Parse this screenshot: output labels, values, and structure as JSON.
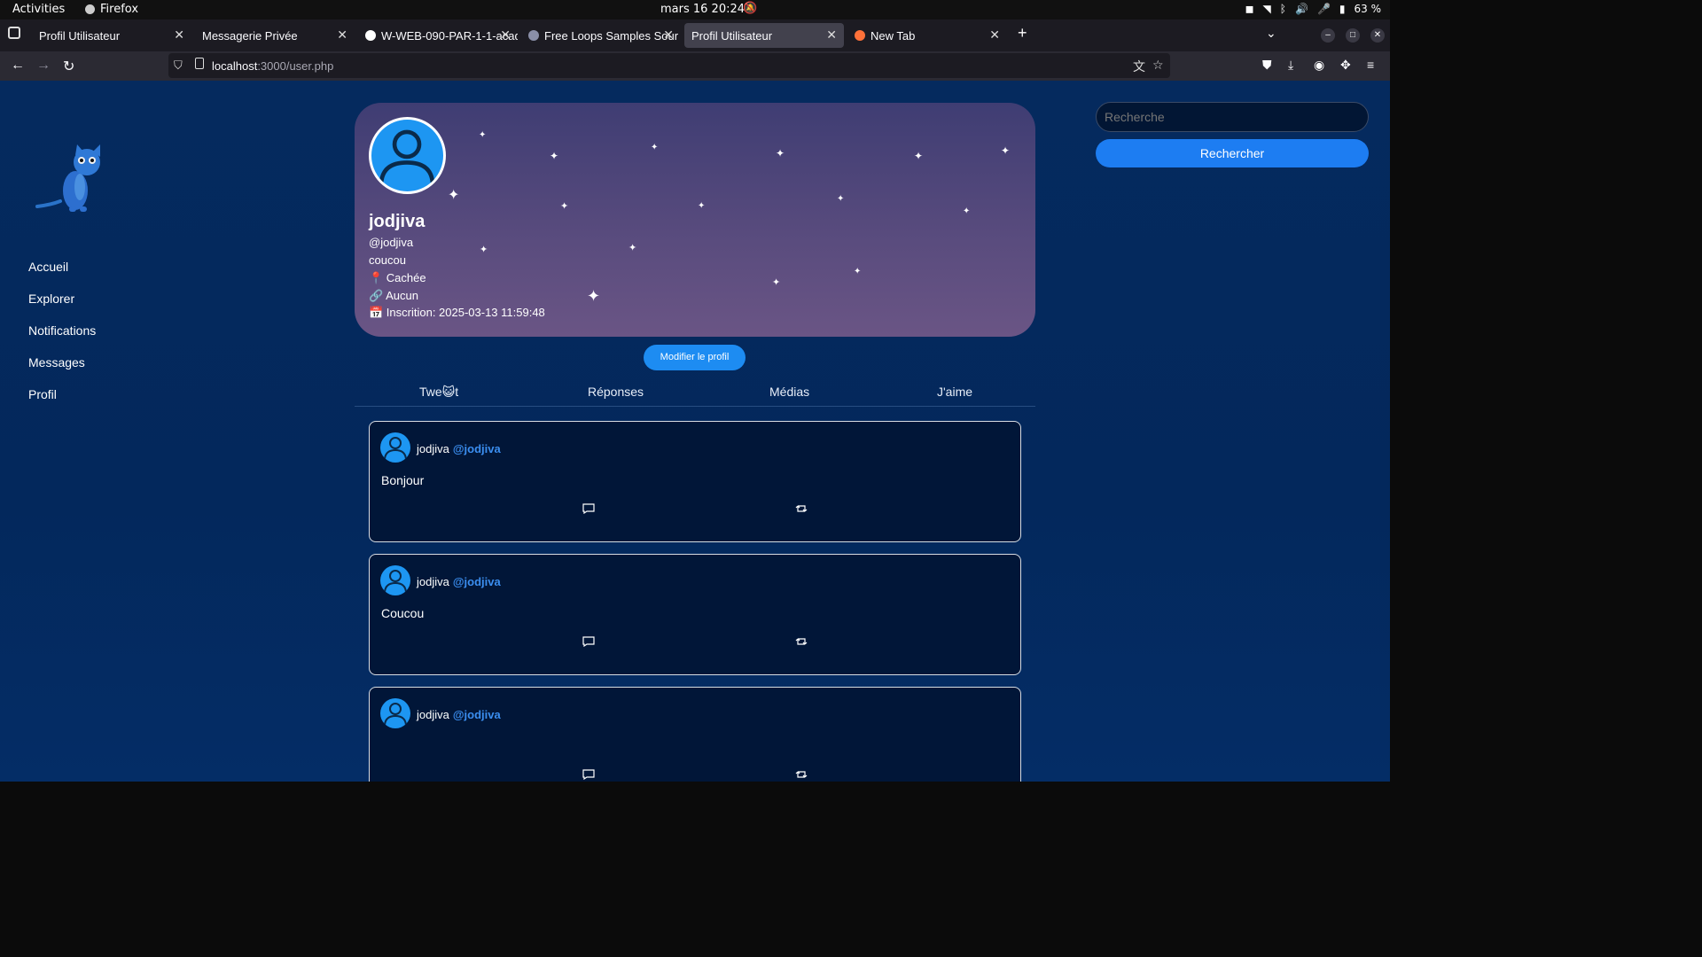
{
  "system": {
    "activities": "Activities",
    "app_name": "Firefox",
    "clock": "mars 16  20:24",
    "battery": "63 %"
  },
  "browser": {
    "tabs": [
      {
        "title": "Profil Utilisateur",
        "active": false
      },
      {
        "title": "Messagerie Privée",
        "active": false
      },
      {
        "title": "W-WEB-090-PAR-1-1-acad",
        "active": false
      },
      {
        "title": "Free Loops Samples Sour",
        "active": false
      },
      {
        "title": "Profil Utilisateur",
        "active": true
      },
      {
        "title": "New Tab",
        "active": false
      }
    ],
    "url_host": "localhost",
    "url_path": ":3000/user.php"
  },
  "sidebar": {
    "items": [
      {
        "label": "Accueil"
      },
      {
        "label": "Explorer"
      },
      {
        "label": "Notifications"
      },
      {
        "label": "Messages"
      },
      {
        "label": "Profil"
      }
    ]
  },
  "profile": {
    "name": "jodjiva",
    "handle": "@jodjiva",
    "bio": "coucou",
    "location": "📍 Cachée",
    "website": "🔗 Aucun",
    "joined": "📅 Inscrition: 2025-03-13 11:59:48",
    "edit_label": "Modifier le profil"
  },
  "profile_tabs": [
    "Twe😺t",
    "Réponses",
    "Médias",
    "J'aime"
  ],
  "tweets": [
    {
      "author": "jodjiva",
      "handle": "@jodjiva",
      "text": "Bonjour"
    },
    {
      "author": "jodjiva",
      "handle": "@jodjiva",
      "text": "Coucou"
    },
    {
      "author": "jodjiva",
      "handle": "@jodjiva",
      "text": ""
    }
  ],
  "search": {
    "placeholder": "Recherche",
    "button_label": "Rechercher"
  },
  "colors": {
    "accent": "#1d8cf2",
    "page_bg": "#052a5e",
    "card_bg": "#4f4578",
    "handle": "#3b8ef0"
  }
}
